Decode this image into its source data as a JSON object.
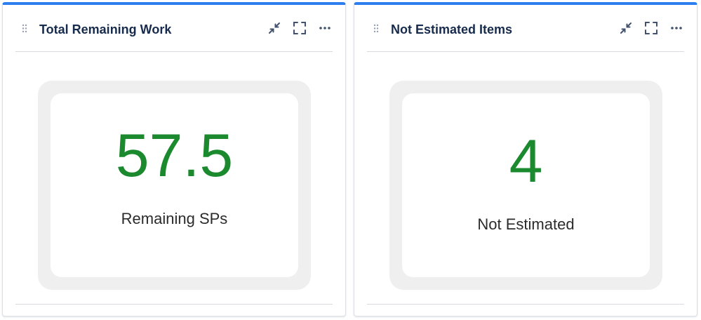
{
  "widgets": [
    {
      "title": "Total Remaining Work",
      "value": "57.5",
      "label": "Remaining SPs",
      "actions": [
        "minimize-icon",
        "fullscreen-icon",
        "more-options-icon"
      ]
    },
    {
      "title": "Not Estimated Items",
      "value": "4",
      "label": "Not Estimated",
      "actions": [
        "minimize-icon",
        "fullscreen-icon",
        "more-options-icon"
      ]
    }
  ],
  "colors": {
    "accent": "#2d7ff0",
    "value": "#1b8a2f",
    "title": "#172b4d",
    "icon": "#42526e"
  }
}
